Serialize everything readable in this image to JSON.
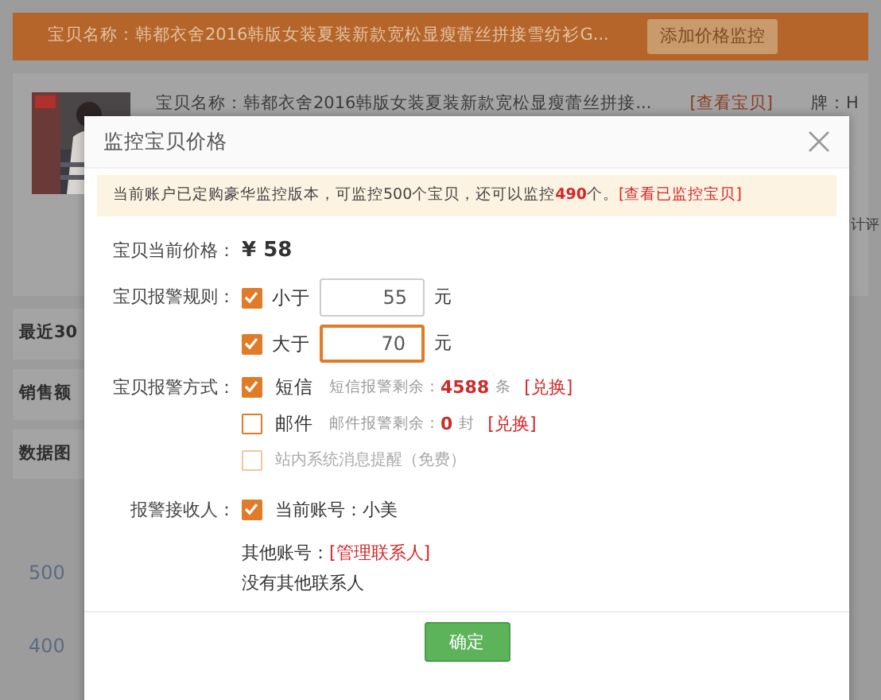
{
  "page": {
    "top_bar": {
      "title": "宝贝名称：韩都衣舍2016韩版女装夏装新款宽松显瘦蕾丝拼接雪纺衫G...",
      "button": "添加价格监控"
    },
    "product": {
      "name": "宝贝名称：韩都衣舍2016韩版女装夏装新款宽松显瘦蕾丝拼接...",
      "link": "[查看宝贝]",
      "side_text_1": "牌：H",
      "side_text_2": "计评"
    },
    "side_tabs": [
      "最近30",
      "销售额",
      "数据图"
    ],
    "chart_ticks": [
      "500",
      "400"
    ]
  },
  "dialog": {
    "title": "监控宝贝价格",
    "notice": {
      "text": "当前账户已定购豪华监控版本，可监控500个宝贝，还可以监控**490**个。",
      "link": "[查看已监控宝贝]"
    },
    "price": {
      "label": "宝贝当前价格：",
      "value": "¥ 58"
    },
    "rules": {
      "label": "宝贝报警规则：",
      "items": [
        {
          "checked": true,
          "label": "小于",
          "value": "55",
          "unit": "元",
          "focused": false
        },
        {
          "checked": true,
          "label": "大于",
          "value": "70",
          "unit": "元",
          "focused": true
        }
      ]
    },
    "methods": {
      "label": "宝贝报警方式：",
      "items": [
        {
          "kind": "quota",
          "checked": true,
          "disabled": false,
          "label": "短信",
          "note": "短信报警剩余：",
          "count": "4588",
          "unit": "条",
          "link": "[兑换]"
        },
        {
          "kind": "quota",
          "checked": false,
          "disabled": false,
          "label": "邮件",
          "note": "邮件报警剩余：",
          "count": "0",
          "unit": "封",
          "link": "[兑换]"
        },
        {
          "kind": "plain",
          "checked": false,
          "disabled": true,
          "label": "站内系统消息提醒（免费）"
        }
      ]
    },
    "receiver": {
      "label": "报警接收人：",
      "current": {
        "checked": true,
        "label": "当前账号：小美"
      },
      "other_label": "其他账号：",
      "other_link": "[管理联系人]",
      "empty": "没有其他联系人"
    },
    "confirm": "确定"
  }
}
